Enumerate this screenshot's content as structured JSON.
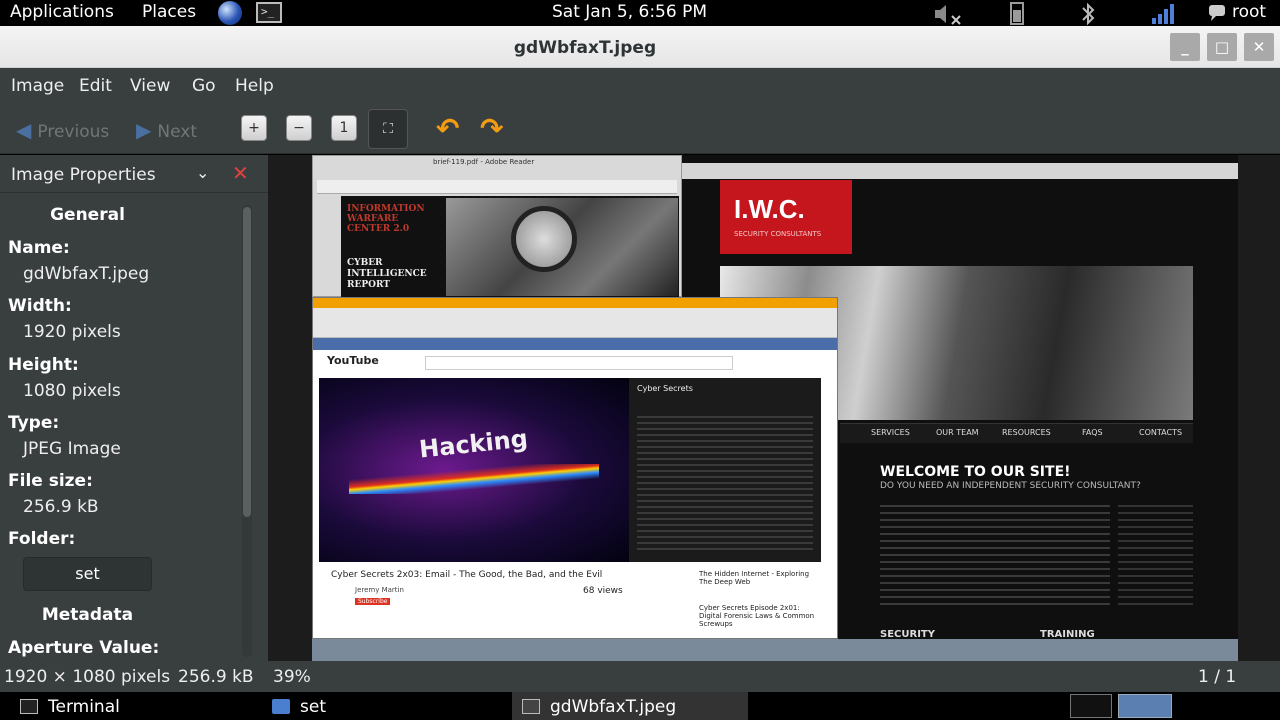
{
  "top_panel": {
    "applications": "Applications",
    "places": "Places",
    "clock": "Sat Jan  5,  6:56 PM",
    "user": "root"
  },
  "window": {
    "title": "gdWbfaxT.jpeg"
  },
  "menu": {
    "image": "Image",
    "edit": "Edit",
    "view": "View",
    "go": "Go",
    "help": "Help"
  },
  "toolbar": {
    "previous": "Previous",
    "next": "Next"
  },
  "sidebar": {
    "title": "Image Properties",
    "general_heading": "General",
    "name_label": "Name:",
    "name_value": "gdWbfaxT.jpeg",
    "width_label": "Width:",
    "width_value": "1920 pixels",
    "height_label": "Height:",
    "height_value": "1080 pixels",
    "type_label": "Type:",
    "type_value": "JPEG Image",
    "filesize_label": "File size:",
    "filesize_value": "256.9 kB",
    "folder_label": "Folder:",
    "folder_button": "set",
    "metadata_heading": "Metadata",
    "aperture_label": "Aperture Value:"
  },
  "photo": {
    "reader_title": "brief-119.pdf - Adobe Reader",
    "iwc_title": "INFORMATION WARFARE CENTER 2.0",
    "iwc_subtitle": "CYBER INTELLIGENCE REPORT",
    "iwc_logo": "I.W.C.",
    "iwc_logo_sub": "SECURITY CONSULTANTS",
    "iwc_nav": [
      "SERVICES",
      "OUR TEAM",
      "RESOURCES",
      "FAQS",
      "CONTACTS"
    ],
    "iwc_welcome": "WELCOME TO OUR SITE!",
    "iwc_welcome_sub": "DO YOU NEED AN INDEPENDENT SECURITY CONSULTANT?",
    "iwc_bottom": [
      "SECURITY",
      "TRAINING"
    ],
    "yt_logo": "YouTube",
    "yt_video_text": "Hacking",
    "yt_video_title": "Cyber Secrets 2x03: Email - The Good, the Bad, and the Evil",
    "yt_channel": "Jeremy Martin",
    "yt_views": "68 views",
    "yt_subscribe": "Subscribe",
    "yt_playlist_title": "Cyber Secrets",
    "yt_related": [
      "The Hidden Internet - Exploring The Deep Web",
      "Cyber Secrets Episode 2x01: Digital Forensic Laws & Common Screwups"
    ]
  },
  "status": {
    "dimensions": "1920 × 1080 pixels",
    "size": "256.9 kB",
    "zoom": "39%",
    "position": "1 / 1"
  },
  "taskbar": {
    "terminal": "Terminal",
    "set": "set",
    "viewer": "gdWbfaxT.jpeg"
  }
}
